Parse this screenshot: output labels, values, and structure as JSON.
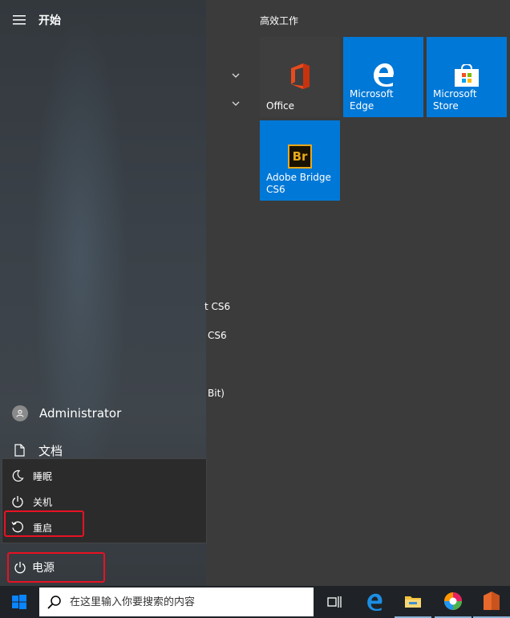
{
  "start_menu": {
    "title": "开始",
    "group_title": "高效工作",
    "peek_texts": [
      "t CS6",
      "CS6",
      "Bit)"
    ],
    "tiles": [
      {
        "label": "Office",
        "color": "#3e3e3e",
        "icon": "office-icon"
      },
      {
        "label": "Microsoft Edge",
        "color": "#0078d7",
        "icon": "edge-icon"
      },
      {
        "label": "Microsoft Store",
        "color": "#0078d7",
        "icon": "store-icon"
      },
      {
        "label": "Adobe Bridge CS6",
        "color": "#0078d7",
        "icon": "bridge-icon",
        "icon_text": "Br"
      }
    ],
    "user": {
      "name": "Administrator"
    },
    "documents": {
      "label": "文档"
    },
    "power_menu": {
      "items": [
        {
          "label": "睡眠",
          "icon": "moon-icon"
        },
        {
          "label": "关机",
          "icon": "power-icon"
        },
        {
          "label": "重启",
          "icon": "restart-icon"
        }
      ]
    },
    "power": {
      "label": "电源"
    }
  },
  "taskbar": {
    "search_placeholder": "在这里输入你要搜索的内容",
    "pinned": [
      "task-view-icon",
      "edge-icon",
      "file-explorer-icon",
      "colorful-app-icon",
      "orange-app-icon"
    ]
  },
  "colors": {
    "accent": "#0078d7",
    "highlight": "#e81123"
  }
}
